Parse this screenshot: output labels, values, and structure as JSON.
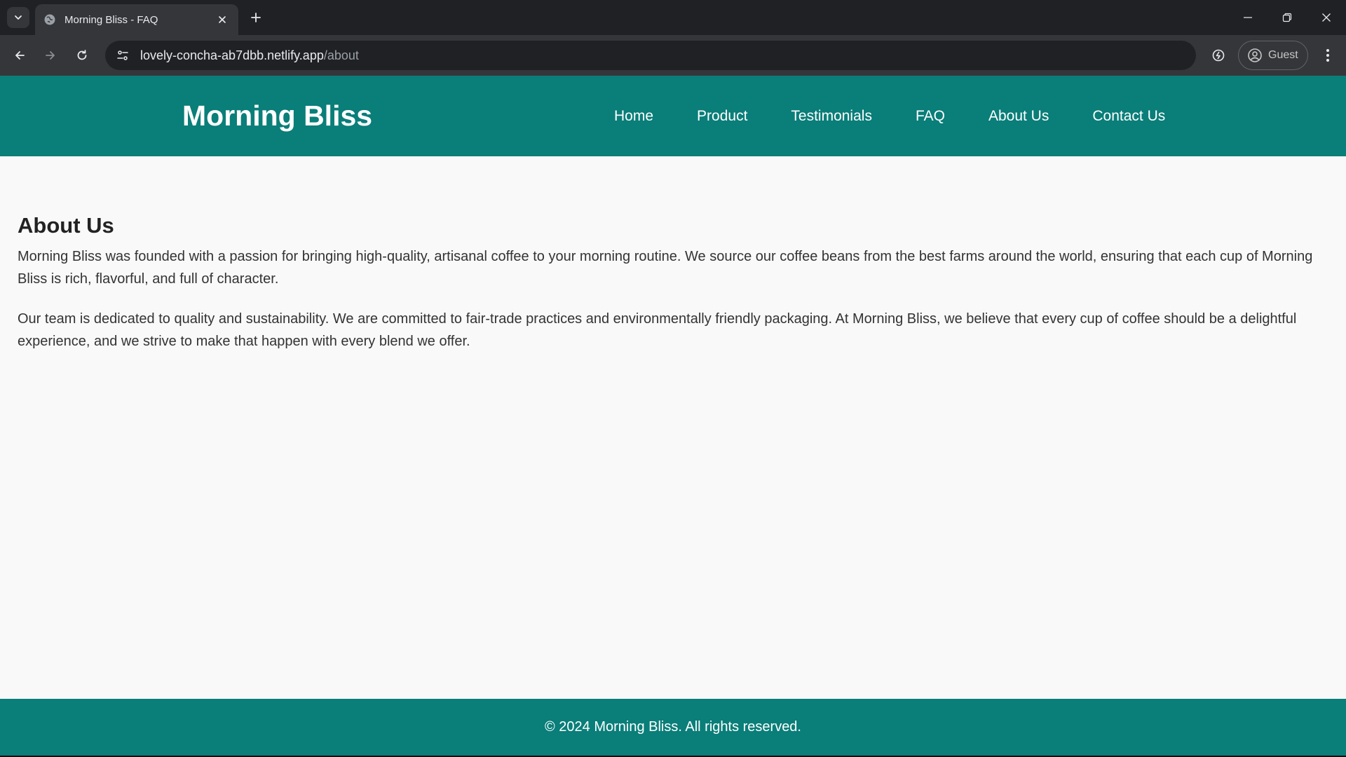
{
  "browser": {
    "tab_title": "Morning Bliss - FAQ",
    "url_host": "lovely-concha-ab7dbb.netlify.app",
    "url_path": "/about",
    "profile_label": "Guest",
    "icons": {
      "tab_search": "chevron-down-icon",
      "favicon": "globe-icon",
      "tab_close": "close-icon",
      "new_tab": "plus-icon",
      "minimize": "minimize-icon",
      "restore": "restore-icon",
      "close_window": "close-icon",
      "back": "arrow-left-icon",
      "forward": "arrow-right-icon",
      "reload": "reload-icon",
      "site_info": "tune-icon",
      "extension": "performance-icon",
      "profile": "account-circle-icon",
      "menu": "more-vert-icon"
    }
  },
  "site": {
    "brand": "Morning Bliss",
    "nav": [
      "Home",
      "Product",
      "Testimonials",
      "FAQ",
      "About Us",
      "Contact Us"
    ],
    "colors": {
      "header_bg": "#0a7e79",
      "page_bg": "#f9f9f9",
      "text": "#333333"
    }
  },
  "about": {
    "heading": "About Us",
    "paragraphs": [
      "Morning Bliss was founded with a passion for bringing high-quality, artisanal coffee to your morning routine. We source our coffee beans from the best farms around the world, ensuring that each cup of Morning Bliss is rich, flavorful, and full of character.",
      "Our team is dedicated to quality and sustainability. We are committed to fair-trade practices and environmentally friendly packaging. At Morning Bliss, we believe that every cup of coffee should be a delightful experience, and we strive to make that happen with every blend we offer."
    ]
  },
  "footer": {
    "text": "© 2024 Morning Bliss. All rights reserved."
  }
}
